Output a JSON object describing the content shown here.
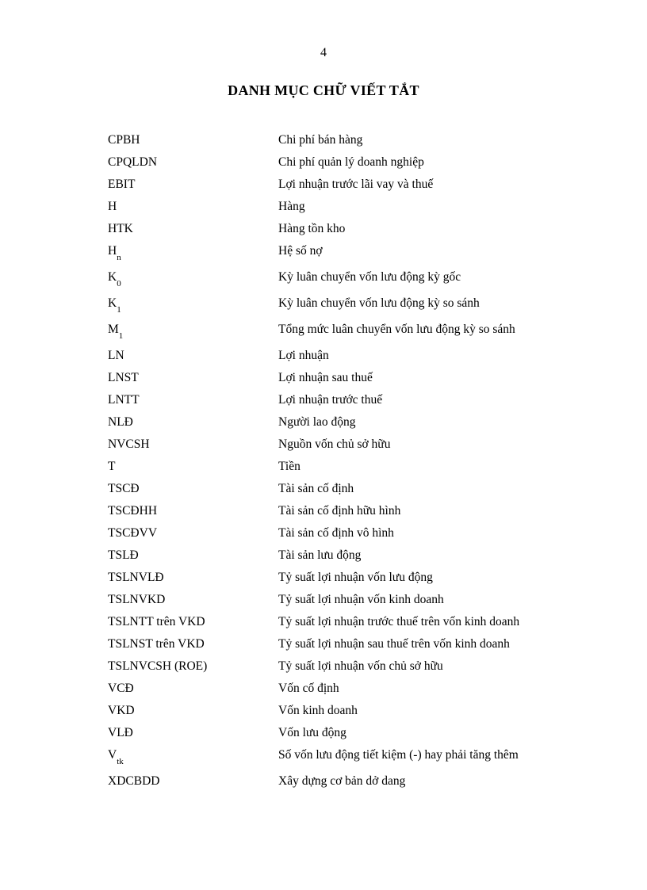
{
  "page_number": "4",
  "heading": "DANH MỤC CHỮ VIẾT TẮT",
  "rows": [
    {
      "abbr": "CPBH",
      "def": "Chi phí bán hàng"
    },
    {
      "abbr": "CPQLDN",
      "def": "Chi phí quản lý doanh nghiệp"
    },
    {
      "abbr": "EBIT",
      "def": "Lợi nhuận trước lãi vay và thuế"
    },
    {
      "abbr": "H",
      "def": "Hàng"
    },
    {
      "abbr": "HTK",
      "def": "Hàng tồn kho"
    },
    {
      "abbr_base": "H",
      "abbr_sub": "n",
      "def": "Hệ số nợ"
    },
    {
      "abbr_base": "K",
      "abbr_sub": "0",
      "def": "Kỳ luân chuyển vốn lưu động kỳ gốc"
    },
    {
      "abbr_base": "K",
      "abbr_sub": "1",
      "def": "Kỳ luân chuyển vốn lưu động kỳ so sánh"
    },
    {
      "abbr_base": "M",
      "abbr_sub": "1",
      "def": "Tổng mức luân chuyển vốn lưu động kỳ so sánh"
    },
    {
      "abbr": "LN",
      "def": "Lợi nhuận"
    },
    {
      "abbr": "LNST",
      "def": "Lợi nhuận sau thuế"
    },
    {
      "abbr": "LNTT",
      "def": "Lợi nhuận trước thuế"
    },
    {
      "abbr": "NLĐ",
      "def": "Người lao động"
    },
    {
      "abbr": "NVCSH",
      "def": "Nguồn vốn chủ sở hữu"
    },
    {
      "abbr": "T",
      "def": "Tiền"
    },
    {
      "abbr": "TSCĐ",
      "def": "Tài sản cố định"
    },
    {
      "abbr": "TSCĐHH",
      "def": "Tài sản cố định hữu hình"
    },
    {
      "abbr": "TSCĐVV",
      "def": "Tài sản cố định vô hình"
    },
    {
      "abbr": "TSLĐ",
      "def": "Tài sản lưu động"
    },
    {
      "abbr": "TSLNVLĐ",
      "def": "Tỷ suất lợi nhuận vốn lưu động"
    },
    {
      "abbr": "TSLNVKD",
      "def": "Tỷ suất lợi nhuận vốn kinh doanh"
    },
    {
      "abbr": "TSLNTT  trên VKD",
      "def": "Tỷ suất lợi nhuận trước thuế trên vốn kinh doanh"
    },
    {
      "abbr": "TSLNST  trên VKD",
      "def": "Tỷ suất lợi nhuận sau thuế trên vốn kinh doanh"
    },
    {
      "abbr": "TSLNVCSH  (ROE)",
      "def": "Tỷ suất lợi nhuận vốn chủ sở hữu"
    },
    {
      "abbr": "VCĐ",
      "def": "Vốn cố định"
    },
    {
      "abbr": "VKD",
      "def": "Vốn kinh doanh"
    },
    {
      "abbr": "VLĐ",
      "def": "Vốn lưu động"
    },
    {
      "abbr_base": "V",
      "abbr_sub": "tk",
      "def": "Số vốn lưu động tiết kiệm (-) hay phải tăng thêm"
    },
    {
      "abbr": "XDCBDD",
      "def": "Xây dựng cơ bản dở dang"
    }
  ]
}
